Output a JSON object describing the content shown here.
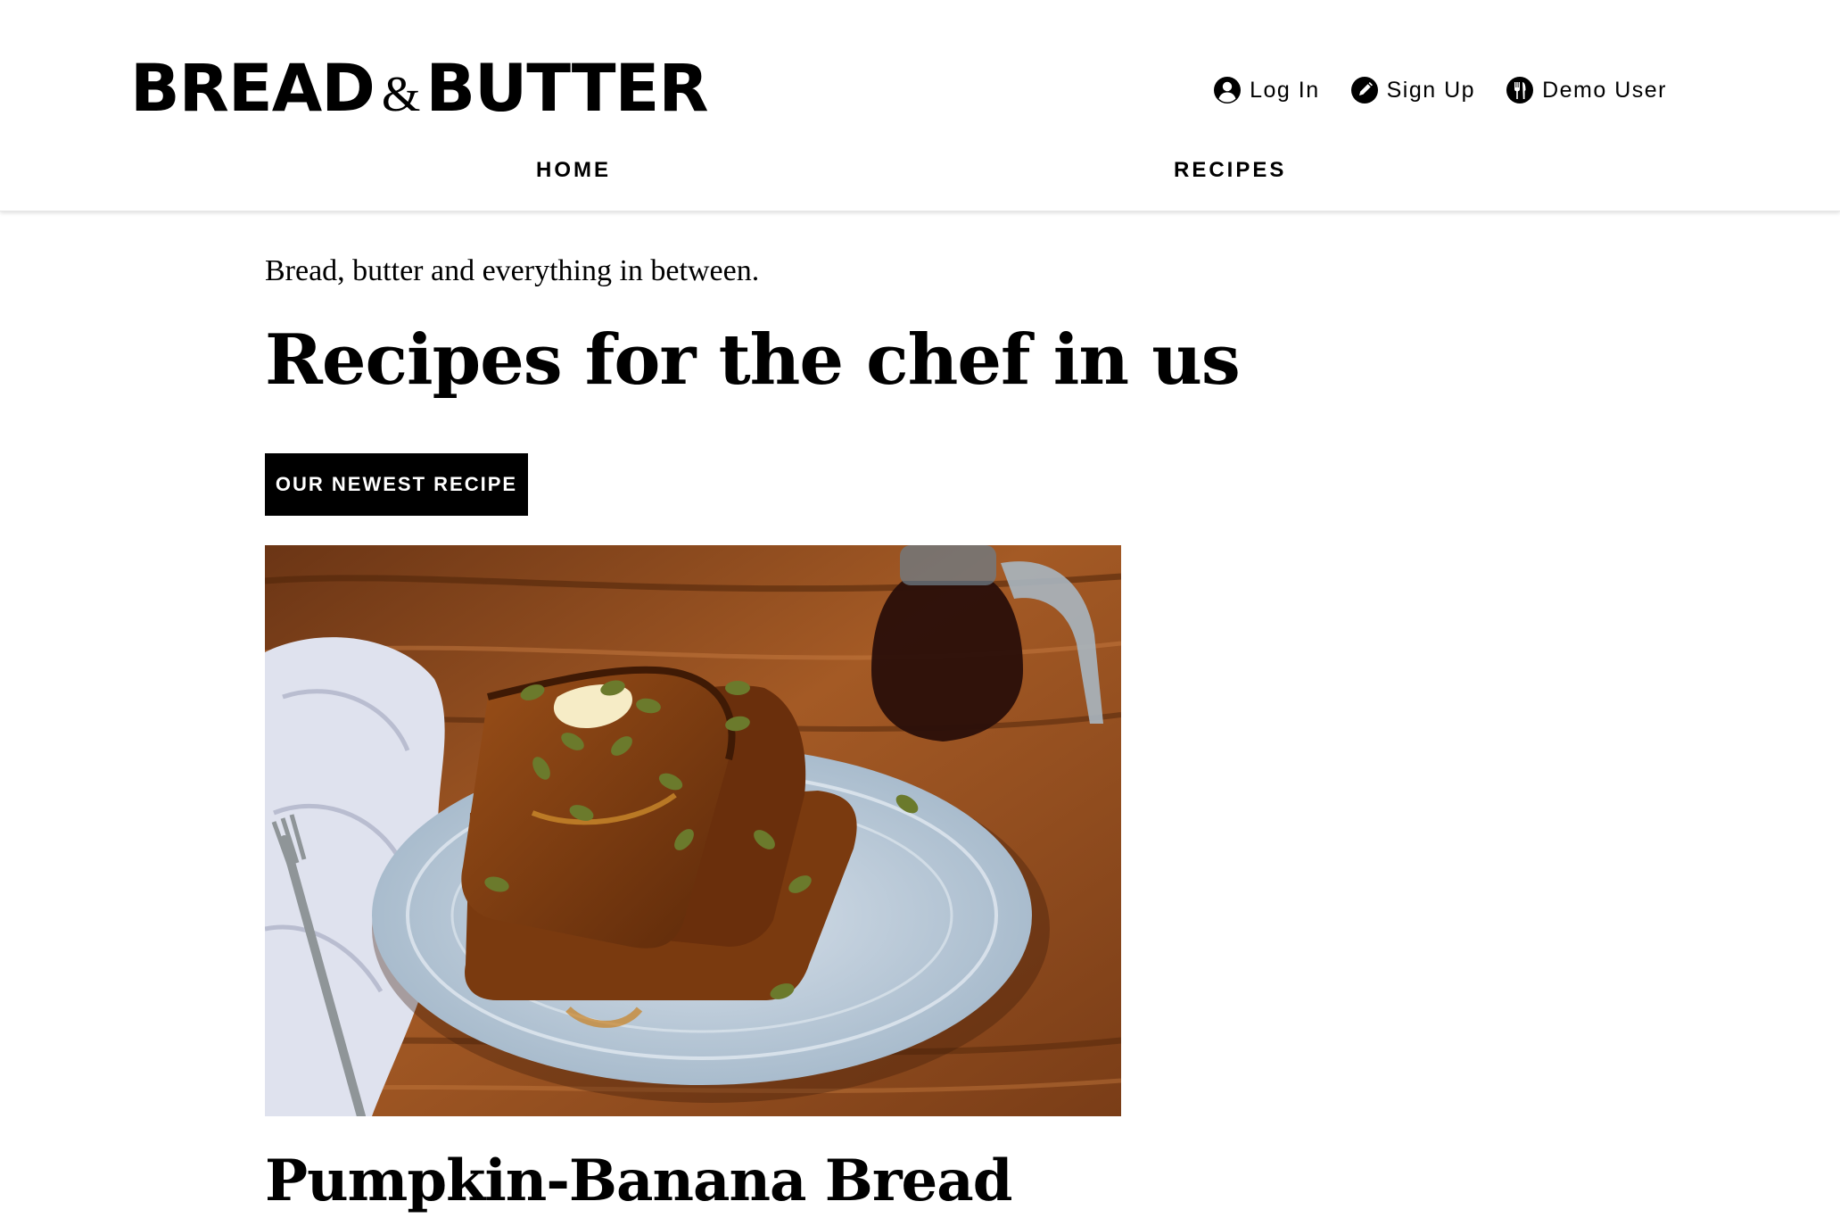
{
  "header": {
    "logo": {
      "word1": "BREAD",
      "amp": "&",
      "word2": "BUTTER"
    },
    "auth": [
      {
        "label": "Log In",
        "icon": "user-circle-icon"
      },
      {
        "label": "Sign Up",
        "icon": "pencil-circle-icon"
      },
      {
        "label": "Demo User",
        "icon": "utensils-circle-icon"
      }
    ],
    "nav": [
      {
        "label": "HOME"
      },
      {
        "label": "RECIPES"
      }
    ]
  },
  "main": {
    "tagline": "Bread, butter and everything in between.",
    "headline": "Recipes for the chef in us",
    "cta_label": "OUR NEWEST RECIPE",
    "featured": {
      "title": "Pumpkin-Banana Bread"
    }
  },
  "colors": {
    "text": "#000000",
    "button_bg": "#000000",
    "button_text": "#ffffff",
    "background": "#ffffff"
  }
}
